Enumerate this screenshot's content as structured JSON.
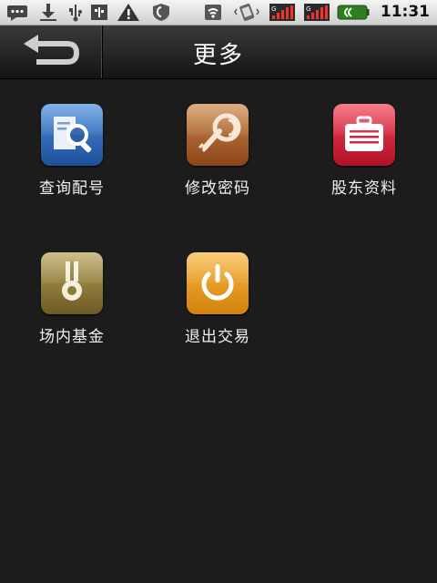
{
  "status_bar": {
    "time": "11:31",
    "icons": [
      "chat-icon",
      "download-icon",
      "usb-icon",
      "warning-icon",
      "shield-icon",
      "wifi-icon",
      "vibrate-icon",
      "signal-icon",
      "signal-icon",
      "battery-icon"
    ]
  },
  "header": {
    "title": "更多",
    "back_icon": "back-arrow-icon"
  },
  "menu": {
    "items": [
      {
        "label": "查询配号",
        "icon": "search-document-icon",
        "color": "#2d6fc1"
      },
      {
        "label": "修改密码",
        "icon": "key-icon",
        "color": "#b0642a"
      },
      {
        "label": "股东资料",
        "icon": "briefcase-icon",
        "color": "#d8243a"
      },
      {
        "label": "场内基金",
        "icon": "medal-icon",
        "color": "#8e7a38"
      },
      {
        "label": "退出交易",
        "icon": "power-icon",
        "color": "#e79a17"
      }
    ]
  }
}
